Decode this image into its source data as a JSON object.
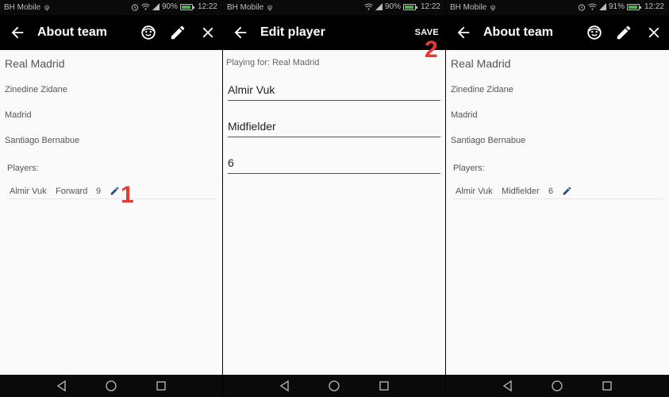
{
  "colors": {
    "appbar": "#000000",
    "background": "#fafafa",
    "annotation": "#e53935",
    "edit_icon": "#2c4a8a"
  },
  "status": {
    "carrier": "BH Mobile",
    "battery": "90%",
    "battery_third": "91%",
    "time": "12:22"
  },
  "screen1": {
    "title": "About team",
    "team": {
      "name": "Real Madrid",
      "coach": "Zinedine Zidane",
      "city": "Madrid",
      "stadium": "Santiago Bernabue"
    },
    "players_label": "Players:",
    "player": {
      "name": "Almir Vuk",
      "position": "Forward",
      "number": "9"
    },
    "annotation": "1"
  },
  "screen2": {
    "title": "Edit player",
    "save_label": "SAVE",
    "playing_for": "Playing for: Real Madrid",
    "fields": {
      "name": "Almir Vuk",
      "position": "Midfielder",
      "number": "6"
    },
    "annotation": "2"
  },
  "screen3": {
    "title": "About team",
    "team": {
      "name": "Real Madrid",
      "coach": "Zinedine Zidane",
      "city": "Madrid",
      "stadium": "Santiago Bernabue"
    },
    "players_label": "Players:",
    "player": {
      "name": "Almir Vuk",
      "position": "Midfielder",
      "number": "6"
    }
  }
}
